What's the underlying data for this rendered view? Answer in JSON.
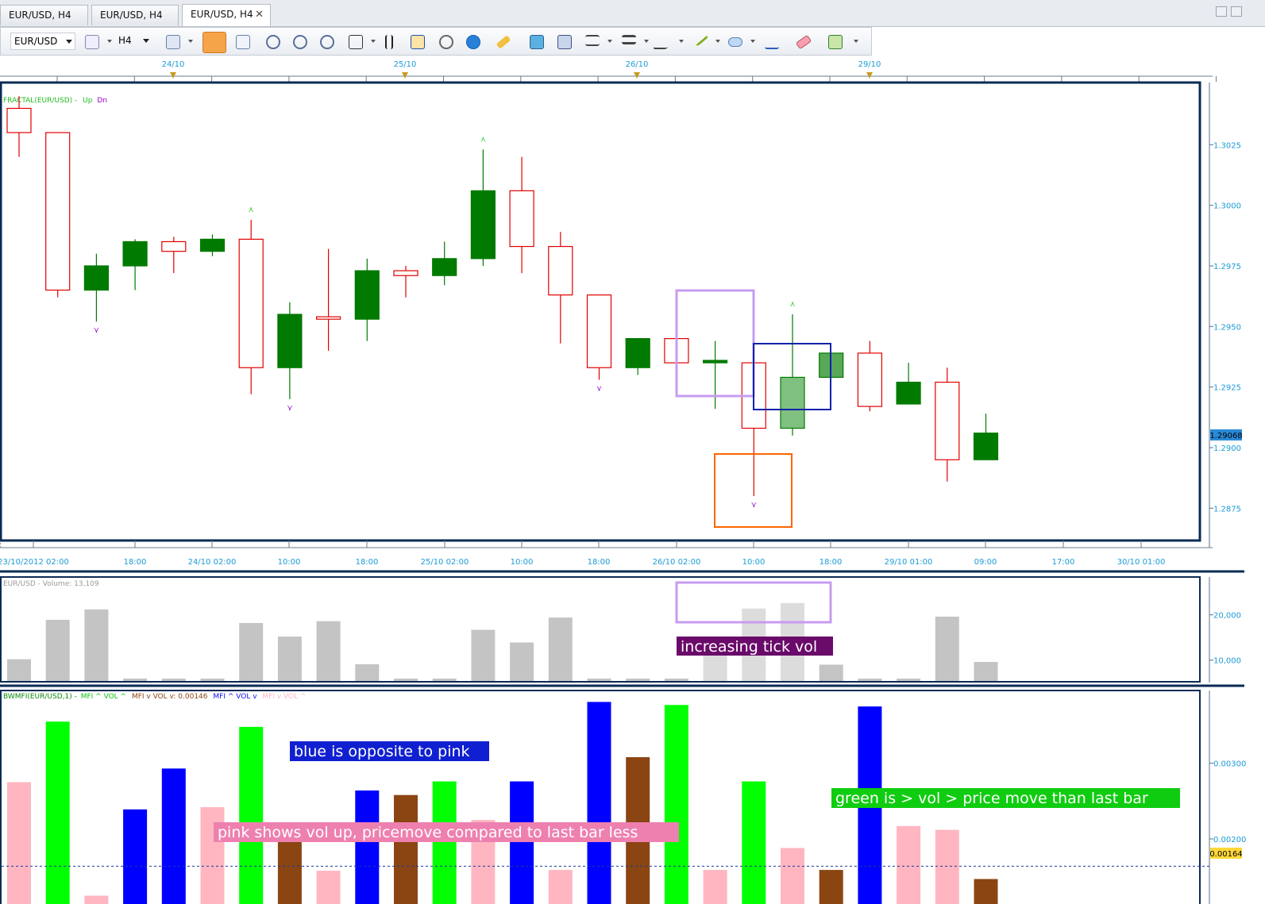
{
  "tabs": [
    {
      "label": "EUR/USD, H4",
      "active": false
    },
    {
      "label": "EUR/USD, H4",
      "active": false
    },
    {
      "label": "EUR/USD, H4",
      "active": true
    }
  ],
  "toolbar": {
    "symbol": "EUR/USD",
    "period": "H4",
    "icons": [
      "chart-type-icon",
      "cursor-icon",
      "crosshair-icon",
      "zoom-icon",
      "zoom-out-icon",
      "zoom-rect-icon",
      "shift-icon",
      "indicator-icon",
      "template-icon",
      "refresh-icon",
      "globe-icon",
      "ruler-icon",
      "image-icon",
      "export-icon",
      "fibonacci-icon",
      "lines-icon",
      "pen-icon",
      "trendline-icon",
      "ellipse-icon",
      "text-icon",
      "eraser-icon",
      "tree-icon"
    ]
  },
  "top_axis": {
    "labels": [
      "24/10",
      "25/10",
      "26/10",
      "29/10"
    ]
  },
  "x_axis": {
    "labels": [
      "23/10/2012 02:00",
      "18:00",
      "24/10 02:00",
      "10:00",
      "18:00",
      "25/10 02:00",
      "10:00",
      "18:00",
      "26/10 02:00",
      "10:00",
      "18:00",
      "29/10 01:00",
      "09:00",
      "17:00",
      "30/10 01:00"
    ]
  },
  "price_panel": {
    "legend_name": "FRACTAL(EUR/USD) - ",
    "legend_up": "Up",
    "legend_dn": "Dn",
    "current_price": "1.29068",
    "colors": {
      "bull": "#007a00",
      "bear": "#e00000",
      "axis": "#1a9bd7",
      "border": "#0b2b55"
    }
  },
  "volume_panel": {
    "legend": "EUR/USD - Volume: 13,109",
    "annotation": "increasing tick vol"
  },
  "bwmfi_panel": {
    "legend": [
      {
        "text": "BWMFI(EUR/USD,1) - ",
        "color": "#0b8a0b"
      },
      {
        "text": "MFI ^ VOL ^",
        "color": "#10c010"
      },
      {
        "text": "MFI v VOL v: 0.00146",
        "color": "#8b4513"
      },
      {
        "text": "MFI ^ VOL v",
        "color": "#1010ee"
      },
      {
        "text": "MFI v VOL ^",
        "color": "#ffb6c1"
      }
    ],
    "current_value": "0.00164",
    "annotations": [
      {
        "text": "blue is opposite to pink",
        "bg": "#1020d0"
      },
      {
        "text": "pink shows vol up, pricemove compared to last bar less",
        "bg": "#ee80b0"
      },
      {
        "text": "green is > vol > price move than last bar",
        "bg": "#10cc10"
      }
    ]
  },
  "chart_data": [
    {
      "type": "candlestick",
      "title": "EUR/USD, H4",
      "ylim": [
        1.2862,
        1.305
      ],
      "yticks": [
        "1.2875",
        "1.2900",
        "1.2925",
        "1.2950",
        "1.2975",
        "1.3000",
        "1.3025"
      ],
      "series": [
        {
          "name": "EUR/USD",
          "ohlc": [
            [
              1.304,
              1.3045,
              1.302,
              1.303
            ],
            [
              1.303,
              1.303,
              1.2962,
              1.2965
            ],
            [
              1.2965,
              1.298,
              1.2952,
              1.2975
            ],
            [
              1.2975,
              1.2986,
              1.2965,
              1.2985
            ],
            [
              1.2985,
              1.2987,
              1.2972,
              1.2981
            ],
            [
              1.2981,
              1.2988,
              1.2979,
              1.2986
            ],
            [
              1.2986,
              1.2994,
              1.2922,
              1.2933
            ],
            [
              1.2933,
              1.296,
              1.292,
              1.2955
            ],
            [
              1.2954,
              1.2982,
              1.294,
              1.2953
            ],
            [
              1.2953,
              1.2978,
              1.2944,
              1.2973
            ],
            [
              1.2973,
              1.2975,
              1.2962,
              1.2971
            ],
            [
              1.2971,
              1.2985,
              1.2967,
              1.2978
            ],
            [
              1.2978,
              1.3023,
              1.2975,
              1.3006
            ],
            [
              1.3006,
              1.302,
              1.2972,
              1.2983
            ],
            [
              1.2983,
              1.2989,
              1.2943,
              1.2963
            ],
            [
              1.2963,
              1.2963,
              1.2928,
              1.2933
            ],
            [
              1.2933,
              1.2945,
              1.293,
              1.2945
            ],
            [
              1.2945,
              1.2945,
              1.2934,
              1.2935
            ],
            [
              1.2935,
              1.2944,
              1.2916,
              1.2936
            ],
            [
              1.2935,
              1.2935,
              1.288,
              1.2908
            ],
            [
              1.2908,
              1.2955,
              1.2905,
              1.2929
            ],
            [
              1.2929,
              1.2939,
              1.2929,
              1.2939
            ],
            [
              1.2939,
              1.2944,
              1.2915,
              1.2917
            ],
            [
              1.2918,
              1.2935,
              1.2918,
              1.2927
            ],
            [
              1.2927,
              1.2933,
              1.2886,
              1.2895
            ],
            [
              1.2895,
              1.2914,
              1.2895,
              1.2906
            ]
          ]
        }
      ],
      "fractals_up": [
        {
          "bar": 6,
          "value": 1.2994
        },
        {
          "bar": 12,
          "value": 1.3023
        },
        {
          "bar": 20,
          "value": 1.2955
        }
      ],
      "fractals_down": [
        {
          "bar": 2,
          "value": 1.2952
        },
        {
          "bar": 7,
          "value": 1.292
        },
        {
          "bar": 15,
          "value": 1.2928
        },
        {
          "bar": 19,
          "value": 1.288
        }
      ]
    },
    {
      "type": "bar",
      "title": "Volume",
      "yticks": [
        "10,000",
        "20,000"
      ],
      "ylim": [
        5400,
        28000
      ],
      "values": [
        10200,
        18900,
        21200,
        5500,
        400,
        2300,
        18200,
        15200,
        18600,
        9100,
        2000,
        4000,
        16700,
        13900,
        19400,
        5900,
        1800,
        2400,
        14400,
        21400,
        22600,
        9000,
        4600,
        4600,
        19600,
        9600
      ]
    },
    {
      "type": "bar",
      "title": "BWMFI",
      "yticks": [
        "0.00200",
        "0.00300"
      ],
      "ylim": [
        0.00114,
        0.00394
      ],
      "values": [
        0.00275,
        0.00355,
        0.00125,
        0.00239,
        0.00293,
        0.00242,
        0.00348,
        0.00217,
        0.00158,
        0.00264,
        0.00258,
        0.00276,
        0.00225,
        0.00276,
        0.00159,
        0.00381,
        0.00308,
        0.00377,
        0.00159,
        0.00276,
        0.00188,
        0.00159,
        0.00375,
        0.00217,
        0.00212,
        0.00147
      ],
      "colors": [
        "pink",
        "lime",
        "pink",
        "blue",
        "blue",
        "pink",
        "lime",
        "brown",
        "pink",
        "blue",
        "brown",
        "lime",
        "pink",
        "blue",
        "pink",
        "blue",
        "brown",
        "lime",
        "pink",
        "lime",
        "pink",
        "brown",
        "blue",
        "pink",
        "pink",
        "brown"
      ],
      "reference_value": 0.00164
    }
  ]
}
